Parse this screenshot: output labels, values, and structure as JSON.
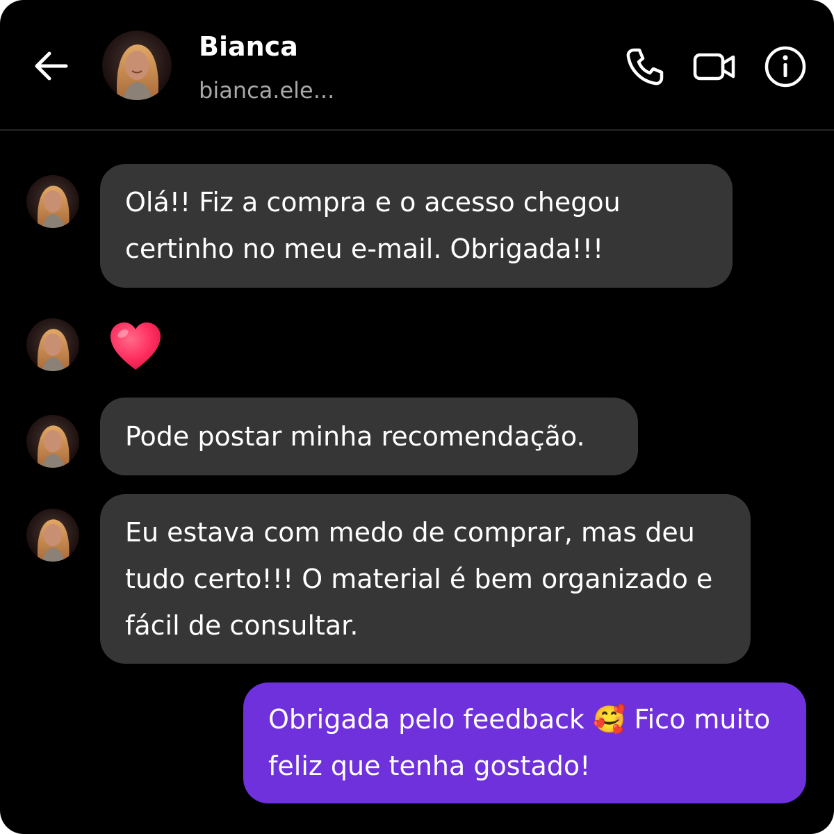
{
  "header": {
    "contact_name": "Bianca",
    "contact_handle": "bianca.ele...",
    "icons": {
      "back": "arrow-left-icon",
      "call": "phone-icon",
      "video": "video-camera-icon",
      "info": "info-icon"
    }
  },
  "messages": [
    {
      "direction": "incoming",
      "text": "Olá!! Fiz a compra e o acesso chegou\ncertinho no meu e-mail. Obrigada!!!"
    },
    {
      "direction": "incoming",
      "type": "emoji",
      "emoji": "heart"
    },
    {
      "direction": "incoming",
      "text": "Pode postar minha recomendação."
    },
    {
      "direction": "incoming",
      "text": "Eu estava com medo de comprar, mas deu\ntudo certo!!! O material é bem organizado e\nfácil de consultar."
    },
    {
      "direction": "outgoing",
      "text": "Obrigada pelo feedback 🥰 Fico muito\nfeliz que tenha gostado!"
    }
  ],
  "colors": {
    "background": "#000000",
    "incoming_bubble": "#363636",
    "outgoing_bubble": "#6f31dc",
    "secondary_text": "#a8a8a8",
    "heart": "#ff2f5f"
  }
}
